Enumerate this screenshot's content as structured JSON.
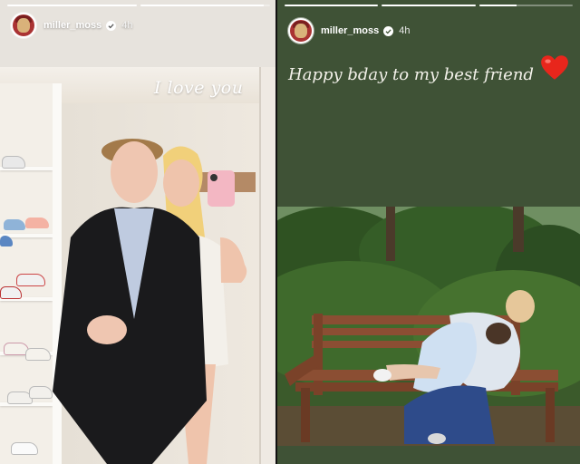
{
  "left_story": {
    "username": "miller_moss",
    "time": "4h",
    "caption": "I love you",
    "progress": [
      1,
      0.95
    ],
    "icons": {
      "avatar": "profile-avatar",
      "verified": "verified-badge-icon"
    }
  },
  "right_story": {
    "username": "miller_moss",
    "time": "4h",
    "caption": "Happy bday to my best friend",
    "progress": [
      1,
      1,
      0.4
    ],
    "icons": {
      "avatar": "profile-avatar",
      "verified": "verified-badge-icon",
      "emoji": "red-heart-icon"
    }
  },
  "colors": {
    "story_green": "#3f5236",
    "heart_red": "#e8261c",
    "text_white": "#ffffff"
  }
}
